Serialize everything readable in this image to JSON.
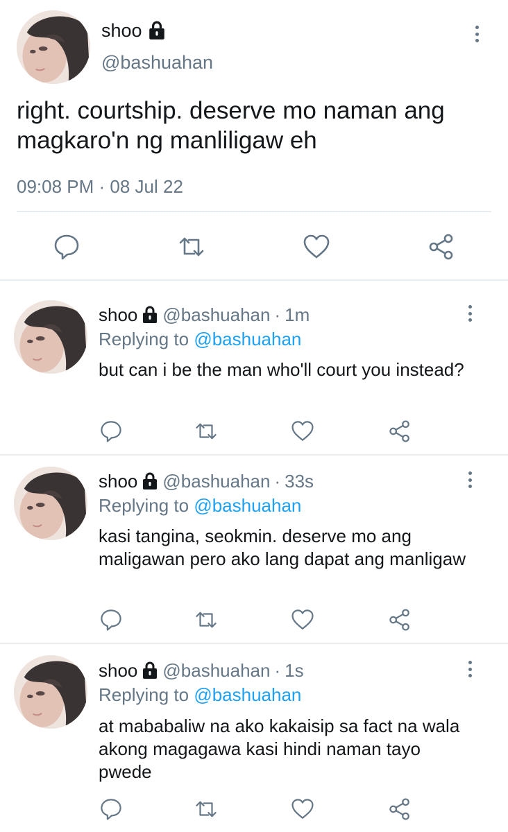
{
  "main_tweet": {
    "name": "shoo",
    "handle": "@bashuahan",
    "text": "right. courtship. deserve mo naman ang magkaro'n ng manliligaw eh",
    "timestamp": "09:08 PM · 08 Jul 22"
  },
  "replies": [
    {
      "name": "shoo",
      "handle": "@bashuahan",
      "separator": "·",
      "time": "1m",
      "replying_prefix": "Replying to",
      "replying_to": "@bashuahan",
      "text": "but can i be the man who'll court you instead?"
    },
    {
      "name": "shoo",
      "handle": "@bashuahan",
      "separator": "·",
      "time": "33s",
      "replying_prefix": "Replying to",
      "replying_to": "@bashuahan",
      "text": "kasi tangina, seokmin. deserve mo ang maligawan pero ako lang dapat ang manligaw"
    },
    {
      "name": "shoo",
      "handle": "@bashuahan",
      "separator": "·",
      "time": "1s",
      "replying_prefix": "Replying to",
      "replying_to": "@bashuahan",
      "text": "at mababaliw na ako kakaisip sa fact na wala akong magagawa kasi hindi naman tayo pwede"
    }
  ],
  "icons": {
    "reply": "speech-bubble-icon",
    "retweet": "retweet-icon",
    "like": "heart-icon",
    "share": "share-icon",
    "protected": "lock-icon",
    "more": "vertical-dots-icon"
  },
  "colors": {
    "text": "#14171a",
    "secondary": "#657786",
    "link": "#1da1f2",
    "divider": "#e6ecf0"
  }
}
